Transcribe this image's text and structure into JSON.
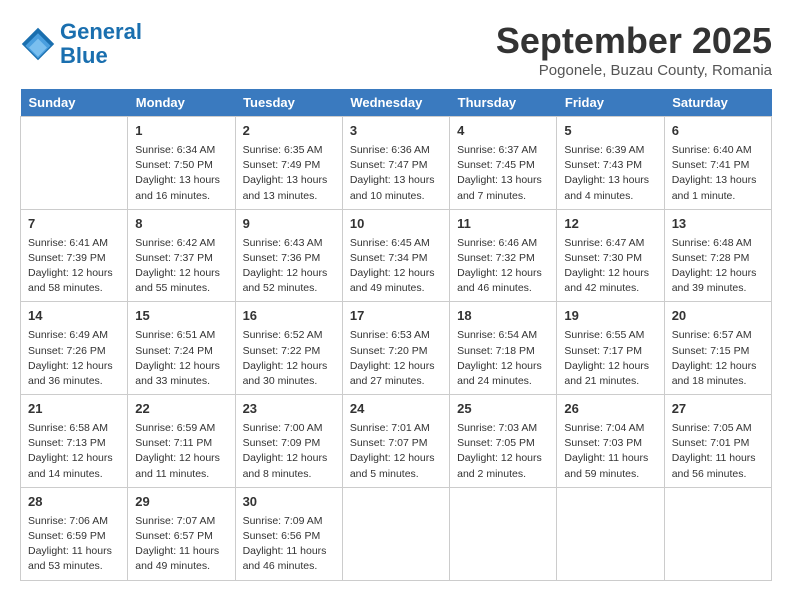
{
  "header": {
    "logo_line1": "General",
    "logo_line2": "Blue",
    "month": "September 2025",
    "location": "Pogonele, Buzau County, Romania"
  },
  "days_of_week": [
    "Sunday",
    "Monday",
    "Tuesday",
    "Wednesday",
    "Thursday",
    "Friday",
    "Saturday"
  ],
  "weeks": [
    [
      {
        "day": "",
        "info": ""
      },
      {
        "day": "1",
        "info": "Sunrise: 6:34 AM\nSunset: 7:50 PM\nDaylight: 13 hours\nand 16 minutes."
      },
      {
        "day": "2",
        "info": "Sunrise: 6:35 AM\nSunset: 7:49 PM\nDaylight: 13 hours\nand 13 minutes."
      },
      {
        "day": "3",
        "info": "Sunrise: 6:36 AM\nSunset: 7:47 PM\nDaylight: 13 hours\nand 10 minutes."
      },
      {
        "day": "4",
        "info": "Sunrise: 6:37 AM\nSunset: 7:45 PM\nDaylight: 13 hours\nand 7 minutes."
      },
      {
        "day": "5",
        "info": "Sunrise: 6:39 AM\nSunset: 7:43 PM\nDaylight: 13 hours\nand 4 minutes."
      },
      {
        "day": "6",
        "info": "Sunrise: 6:40 AM\nSunset: 7:41 PM\nDaylight: 13 hours\nand 1 minute."
      }
    ],
    [
      {
        "day": "7",
        "info": "Sunrise: 6:41 AM\nSunset: 7:39 PM\nDaylight: 12 hours\nand 58 minutes."
      },
      {
        "day": "8",
        "info": "Sunrise: 6:42 AM\nSunset: 7:37 PM\nDaylight: 12 hours\nand 55 minutes."
      },
      {
        "day": "9",
        "info": "Sunrise: 6:43 AM\nSunset: 7:36 PM\nDaylight: 12 hours\nand 52 minutes."
      },
      {
        "day": "10",
        "info": "Sunrise: 6:45 AM\nSunset: 7:34 PM\nDaylight: 12 hours\nand 49 minutes."
      },
      {
        "day": "11",
        "info": "Sunrise: 6:46 AM\nSunset: 7:32 PM\nDaylight: 12 hours\nand 46 minutes."
      },
      {
        "day": "12",
        "info": "Sunrise: 6:47 AM\nSunset: 7:30 PM\nDaylight: 12 hours\nand 42 minutes."
      },
      {
        "day": "13",
        "info": "Sunrise: 6:48 AM\nSunset: 7:28 PM\nDaylight: 12 hours\nand 39 minutes."
      }
    ],
    [
      {
        "day": "14",
        "info": "Sunrise: 6:49 AM\nSunset: 7:26 PM\nDaylight: 12 hours\nand 36 minutes."
      },
      {
        "day": "15",
        "info": "Sunrise: 6:51 AM\nSunset: 7:24 PM\nDaylight: 12 hours\nand 33 minutes."
      },
      {
        "day": "16",
        "info": "Sunrise: 6:52 AM\nSunset: 7:22 PM\nDaylight: 12 hours\nand 30 minutes."
      },
      {
        "day": "17",
        "info": "Sunrise: 6:53 AM\nSunset: 7:20 PM\nDaylight: 12 hours\nand 27 minutes."
      },
      {
        "day": "18",
        "info": "Sunrise: 6:54 AM\nSunset: 7:18 PM\nDaylight: 12 hours\nand 24 minutes."
      },
      {
        "day": "19",
        "info": "Sunrise: 6:55 AM\nSunset: 7:17 PM\nDaylight: 12 hours\nand 21 minutes."
      },
      {
        "day": "20",
        "info": "Sunrise: 6:57 AM\nSunset: 7:15 PM\nDaylight: 12 hours\nand 18 minutes."
      }
    ],
    [
      {
        "day": "21",
        "info": "Sunrise: 6:58 AM\nSunset: 7:13 PM\nDaylight: 12 hours\nand 14 minutes."
      },
      {
        "day": "22",
        "info": "Sunrise: 6:59 AM\nSunset: 7:11 PM\nDaylight: 12 hours\nand 11 minutes."
      },
      {
        "day": "23",
        "info": "Sunrise: 7:00 AM\nSunset: 7:09 PM\nDaylight: 12 hours\nand 8 minutes."
      },
      {
        "day": "24",
        "info": "Sunrise: 7:01 AM\nSunset: 7:07 PM\nDaylight: 12 hours\nand 5 minutes."
      },
      {
        "day": "25",
        "info": "Sunrise: 7:03 AM\nSunset: 7:05 PM\nDaylight: 12 hours\nand 2 minutes."
      },
      {
        "day": "26",
        "info": "Sunrise: 7:04 AM\nSunset: 7:03 PM\nDaylight: 11 hours\nand 59 minutes."
      },
      {
        "day": "27",
        "info": "Sunrise: 7:05 AM\nSunset: 7:01 PM\nDaylight: 11 hours\nand 56 minutes."
      }
    ],
    [
      {
        "day": "28",
        "info": "Sunrise: 7:06 AM\nSunset: 6:59 PM\nDaylight: 11 hours\nand 53 minutes."
      },
      {
        "day": "29",
        "info": "Sunrise: 7:07 AM\nSunset: 6:57 PM\nDaylight: 11 hours\nand 49 minutes."
      },
      {
        "day": "30",
        "info": "Sunrise: 7:09 AM\nSunset: 6:56 PM\nDaylight: 11 hours\nand 46 minutes."
      },
      {
        "day": "",
        "info": ""
      },
      {
        "day": "",
        "info": ""
      },
      {
        "day": "",
        "info": ""
      },
      {
        "day": "",
        "info": ""
      }
    ]
  ]
}
